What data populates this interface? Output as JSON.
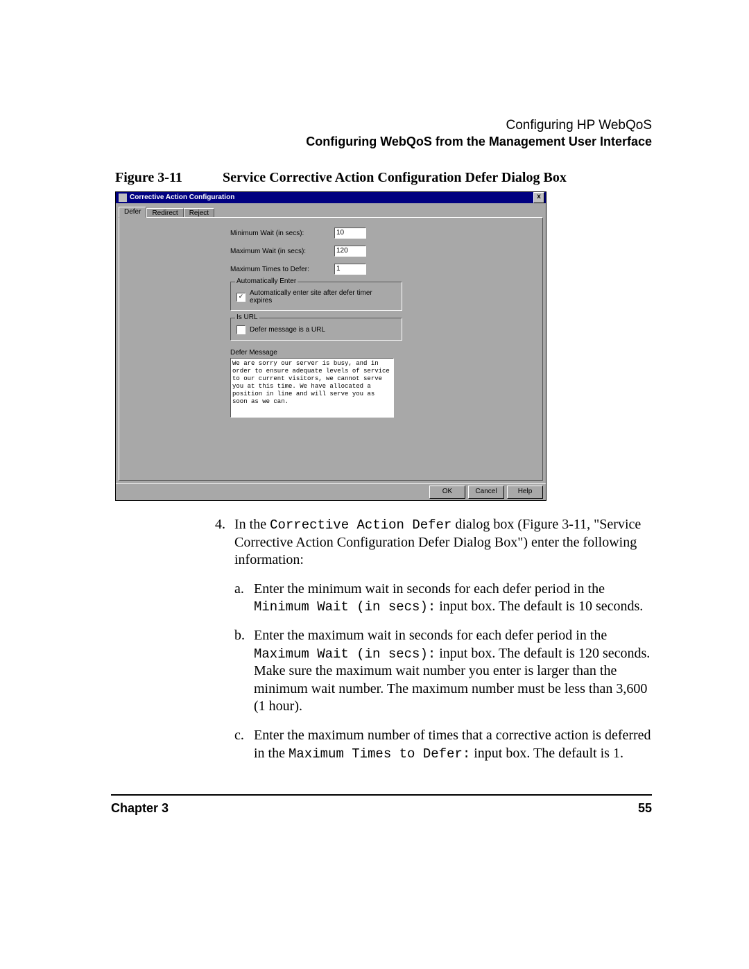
{
  "header": {
    "line1": "Configuring HP WebQoS",
    "line2": "Configuring WebQoS from the Management User Interface"
  },
  "figure": {
    "label": "Figure 3-11",
    "title": "Service Corrective Action Configuration Defer Dialog Box"
  },
  "dialog": {
    "title": "Corrective Action Configuration",
    "close": "x",
    "tabs": {
      "defer": "Defer",
      "redirect": "Redirect",
      "reject": "Reject"
    },
    "fields": {
      "min_wait_label": "Minimum Wait (in secs):",
      "min_wait_value": "10",
      "max_wait_label": "Maximum Wait (in secs):",
      "max_wait_value": "120",
      "max_times_label": "Maximum Times to Defer:",
      "max_times_value": "1"
    },
    "auto_group": {
      "legend": "Automatically Enter",
      "checkbox_label": "Automatically enter site after defer timer expires",
      "checked": "✓"
    },
    "url_group": {
      "legend": "Is URL",
      "checkbox_label": "Defer message is a URL"
    },
    "defer_msg_label": "Defer Message",
    "defer_msg_text": "We are sorry our server is busy, and in order to ensure adequate levels of service to our current visitors, we cannot serve you at this time. We have allocated a position in line and will serve you as soon as we can.",
    "buttons": {
      "ok": "OK",
      "cancel": "Cancel",
      "help": "Help"
    }
  },
  "body": {
    "step4_lead": "In the ",
    "step4_code": "Corrective Action Defer",
    "step4_tail": " dialog box (Figure 3-11, \"Service Corrective Action Configuration Defer Dialog Box\") enter the following information:",
    "a_lead": "Enter the minimum wait in seconds for each defer period in the ",
    "a_code": "Minimum Wait (in secs):",
    "a_tail": " input box. The default is 10 seconds.",
    "b_lead": "Enter the maximum wait in seconds for each defer period in the ",
    "b_code": "Maximum Wait (in secs):",
    "b_tail": " input box. The default is 120 seconds. Make sure the maximum wait number you enter is larger than the minimum wait number. The maximum number must be less than 3,600 (1 hour).",
    "c_lead": "Enter the maximum number of times that a corrective action is deferred in the ",
    "c_code": "Maximum Times to Defer:",
    "c_tail": " input box. The default is 1."
  },
  "footer": {
    "chapter": "Chapter 3",
    "page": "55"
  }
}
